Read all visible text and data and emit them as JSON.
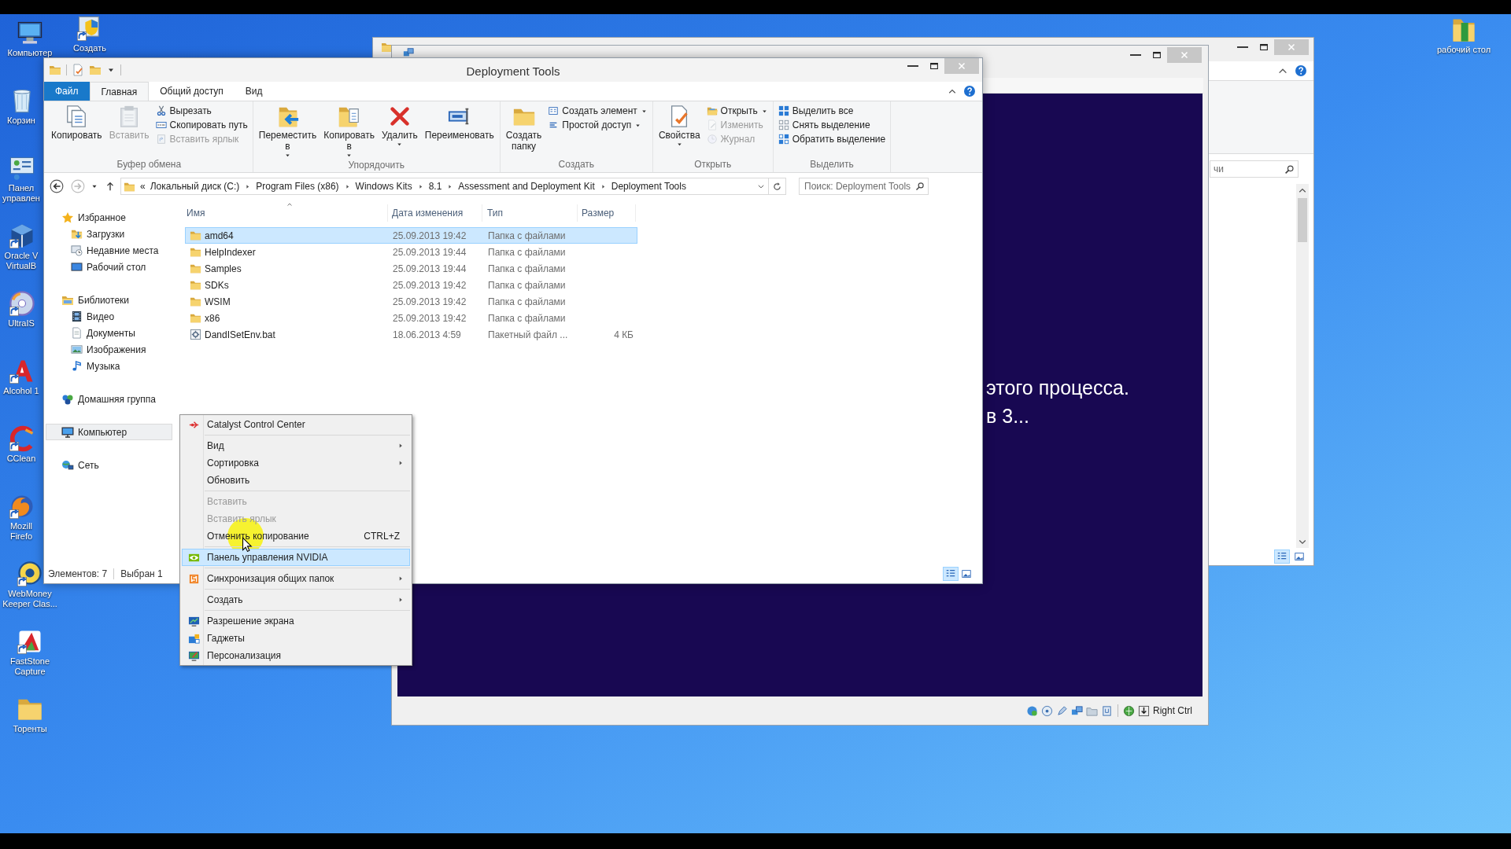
{
  "desktop_icons": [
    {
      "label": "Компьютер",
      "kind": "computer",
      "shortcut": false
    },
    {
      "label": "Корзин",
      "kind": "recycle-bin",
      "shortcut": false
    },
    {
      "label": "Панел управлен",
      "kind": "control-panel",
      "shortcut": false
    },
    {
      "label": "Oracle V VirtualB",
      "kind": "virtualbox",
      "shortcut": true
    },
    {
      "label": "UltraIS",
      "kind": "disc",
      "shortcut": true
    },
    {
      "label": "Alcohol 1",
      "kind": "alcohol",
      "shortcut": true
    },
    {
      "label": "CClean",
      "kind": "ccleaner",
      "shortcut": true
    },
    {
      "label": "Mozill Firefo",
      "kind": "firefox",
      "shortcut": true
    },
    {
      "label": "WebMoney Keeper Clas...",
      "kind": "webmoney",
      "shortcut": true
    },
    {
      "label": "FastStone Capture",
      "kind": "faststone",
      "shortcut": true
    },
    {
      "label": "Торенты",
      "kind": "folder",
      "shortcut": false
    }
  ],
  "desktop_extra_icons": [
    {
      "label": "Создать",
      "kind": "shield",
      "shortcut": true
    },
    {
      "label": "рабочий стол",
      "kind": "green-folder",
      "shortcut": false
    }
  ],
  "back_window": {
    "search": {
      "placeholder": "чи"
    },
    "view_buttons": [
      {
        "selected": true
      },
      {
        "selected": false
      }
    ]
  },
  "virtualbox": {
    "screen_lines": [
      "этого процесса.",
      "в 3..."
    ],
    "host_key": "Right Ctrl"
  },
  "explorer": {
    "title": "Deployment Tools",
    "tabs": [
      {
        "label": "Файл",
        "kind": "file",
        "selected": false
      },
      {
        "label": "Главная",
        "kind": "tab",
        "selected": true
      },
      {
        "label": "Общий доступ",
        "kind": "tab",
        "selected": false
      },
      {
        "label": "Вид",
        "kind": "tab",
        "selected": false
      }
    ],
    "ribbon_groups": [
      {
        "label": "Буфер обмена",
        "items": [
          {
            "kind": "large",
            "label": "Копировать",
            "disabled": false,
            "dropdown": false
          },
          {
            "kind": "large",
            "label": "Вставить",
            "disabled": true,
            "dropdown": false
          },
          {
            "kind": "small",
            "label": "Вырезать",
            "disabled": false,
            "dropdown": false
          },
          {
            "kind": "small",
            "label": "Скопировать путь",
            "disabled": false,
            "dropdown": false
          },
          {
            "kind": "small",
            "label": "Вставить ярлык",
            "disabled": true,
            "dropdown": false
          }
        ]
      },
      {
        "label": "Упорядочить",
        "items": [
          {
            "kind": "large",
            "label": "Переместить в",
            "disabled": false,
            "dropdown": true
          },
          {
            "kind": "large",
            "label": "Копировать в",
            "disabled": false,
            "dropdown": true
          },
          {
            "kind": "large",
            "label": "Удалить",
            "disabled": false,
            "dropdown": true
          },
          {
            "kind": "large",
            "label": "Переименовать",
            "disabled": false,
            "dropdown": false
          }
        ]
      },
      {
        "label": "Создать",
        "items": [
          {
            "kind": "large",
            "label": "Создать папку",
            "disabled": false,
            "dropdown": false
          },
          {
            "kind": "small",
            "label": "Создать элемент",
            "disabled": false,
            "dropdown": true
          },
          {
            "kind": "small",
            "label": "Простой доступ",
            "disabled": false,
            "dropdown": true
          }
        ]
      },
      {
        "label": "Открыть",
        "items": [
          {
            "kind": "large",
            "label": "Свойства",
            "disabled": false,
            "dropdown": true
          },
          {
            "kind": "small",
            "label": "Открыть",
            "disabled": false,
            "dropdown": true
          },
          {
            "kind": "small",
            "label": "Изменить",
            "disabled": true,
            "dropdown": false
          },
          {
            "kind": "small",
            "label": "Журнал",
            "disabled": true,
            "dropdown": false
          }
        ]
      },
      {
        "label": "Выделить",
        "items": [
          {
            "kind": "small",
            "label": "Выделить все",
            "disabled": false,
            "dropdown": false
          },
          {
            "kind": "small",
            "label": "Снять выделение",
            "disabled": false,
            "dropdown": false
          },
          {
            "kind": "small",
            "label": "Обратить выделение",
            "disabled": false,
            "dropdown": false
          }
        ]
      }
    ],
    "address": {
      "overflow": "«",
      "segments": [
        "Локальный диск (C:)",
        "Program Files (x86)",
        "Windows Kits",
        "8.1",
        "Assessment and Deployment Kit",
        "Deployment Tools"
      ]
    },
    "search": {
      "placeholder": "Поиск: Deployment Tools"
    },
    "nav": [
      {
        "label": "Избранное",
        "selected": false,
        "children": [
          {
            "label": "Загрузки",
            "selected": false
          },
          {
            "label": "Недавние места",
            "selected": false
          },
          {
            "label": "Рабочий стол",
            "selected": false
          }
        ]
      },
      {
        "label": "Библиотеки",
        "selected": false,
        "children": [
          {
            "label": "Видео",
            "selected": false
          },
          {
            "label": "Документы",
            "selected": false
          },
          {
            "label": "Изображения",
            "selected": false
          },
          {
            "label": "Музыка",
            "selected": false
          }
        ]
      },
      {
        "label": "Домашняя группа",
        "selected": false
      },
      {
        "label": "Компьютер",
        "selected": true
      },
      {
        "label": "Сеть",
        "selected": false
      }
    ],
    "columns": [
      {
        "label": "Имя",
        "sorted": true
      },
      {
        "label": "Дата изменения",
        "sorted": false
      },
      {
        "label": "Тип",
        "sorted": false
      },
      {
        "label": "Размер",
        "sorted": false
      }
    ],
    "rows": [
      {
        "name": "amd64",
        "date": "25.09.2013 19:42",
        "type": "Папка с файлами",
        "kind": "folder",
        "selected": true
      },
      {
        "name": "HelpIndexer",
        "date": "25.09.2013 19:44",
        "type": "Папка с файлами",
        "kind": "folder",
        "selected": false
      },
      {
        "name": "Samples",
        "date": "25.09.2013 19:44",
        "type": "Папка с файлами",
        "kind": "folder",
        "selected": false
      },
      {
        "name": "SDKs",
        "date": "25.09.2013 19:42",
        "type": "Папка с файлами",
        "kind": "folder",
        "selected": false
      },
      {
        "name": "WSIM",
        "date": "25.09.2013 19:42",
        "type": "Папка с файлами",
        "kind": "folder",
        "selected": false
      },
      {
        "name": "x86",
        "date": "25.09.2013 19:42",
        "type": "Папка с файлами",
        "kind": "folder",
        "selected": false
      },
      {
        "name": "DandISetEnv.bat",
        "date": "18.06.2013 4:59",
        "type": "Пакетный файл ...",
        "size": "4 КБ",
        "kind": "batch",
        "selected": false
      }
    ],
    "status_bar": [
      "Элементов: 7",
      "Выбран 1"
    ],
    "view_buttons": [
      {
        "selected": true
      },
      {
        "selected": false
      }
    ]
  },
  "context_menu": [
    {
      "kind": "item",
      "label": "Catalyst Control Center",
      "disabled": false,
      "submenu": false,
      "selected": false
    },
    {
      "kind": "separator"
    },
    {
      "kind": "item",
      "label": "Вид",
      "disabled": false,
      "submenu": true,
      "selected": false
    },
    {
      "kind": "item",
      "label": "Сортировка",
      "disabled": false,
      "submenu": true,
      "selected": false
    },
    {
      "kind": "item",
      "label": "Обновить",
      "disabled": false,
      "submenu": false,
      "selected": false
    },
    {
      "kind": "separator"
    },
    {
      "kind": "item",
      "label": "Вставить",
      "disabled": true,
      "submenu": false,
      "selected": false
    },
    {
      "kind": "item",
      "label": "Вставить ярлык",
      "disabled": true,
      "submenu": false,
      "selected": false
    },
    {
      "kind": "item",
      "label": "Отменить копирование",
      "shortcut": "CTRL+Z",
      "disabled": false,
      "submenu": false,
      "selected": false
    },
    {
      "kind": "separator"
    },
    {
      "kind": "item",
      "label": "Панель управления NVIDIA",
      "disabled": false,
      "submenu": false,
      "selected": true
    },
    {
      "kind": "separator"
    },
    {
      "kind": "item",
      "label": "Синхронизация общих папок",
      "disabled": false,
      "submenu": true,
      "selected": false
    },
    {
      "kind": "separator"
    },
    {
      "kind": "item",
      "label": "Создать",
      "disabled": false,
      "submenu": true,
      "selected": false
    },
    {
      "kind": "separator"
    },
    {
      "kind": "item",
      "label": "Разрешение экрана",
      "disabled": false,
      "submenu": false,
      "selected": false
    },
    {
      "kind": "item",
      "label": "Гаджеты",
      "disabled": false,
      "submenu": false,
      "selected": false
    },
    {
      "kind": "item",
      "label": "Персонализация",
      "disabled": false,
      "submenu": false,
      "selected": false
    }
  ]
}
